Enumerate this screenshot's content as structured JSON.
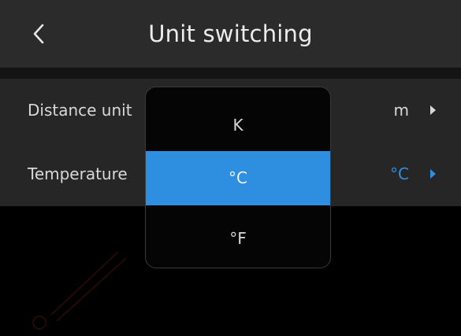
{
  "header": {
    "back_icon": "chevron-left-icon",
    "title": "Unit switching"
  },
  "settings": {
    "rows": [
      {
        "label": "Distance unit",
        "value": "m",
        "active": false,
        "arrow_icon": "caret-right-icon"
      },
      {
        "label": "Temperature",
        "value": "°C",
        "active": true,
        "arrow_icon": "caret-right-icon"
      }
    ]
  },
  "dropdown": {
    "options": [
      {
        "label": "K",
        "selected": false
      },
      {
        "label": "°C",
        "selected": true
      },
      {
        "label": "°F",
        "selected": false
      }
    ]
  },
  "colors": {
    "header_bg": "#2b2b2b",
    "list_bg": "#262626",
    "accent": "#2e8fe0",
    "background": "#000000"
  }
}
